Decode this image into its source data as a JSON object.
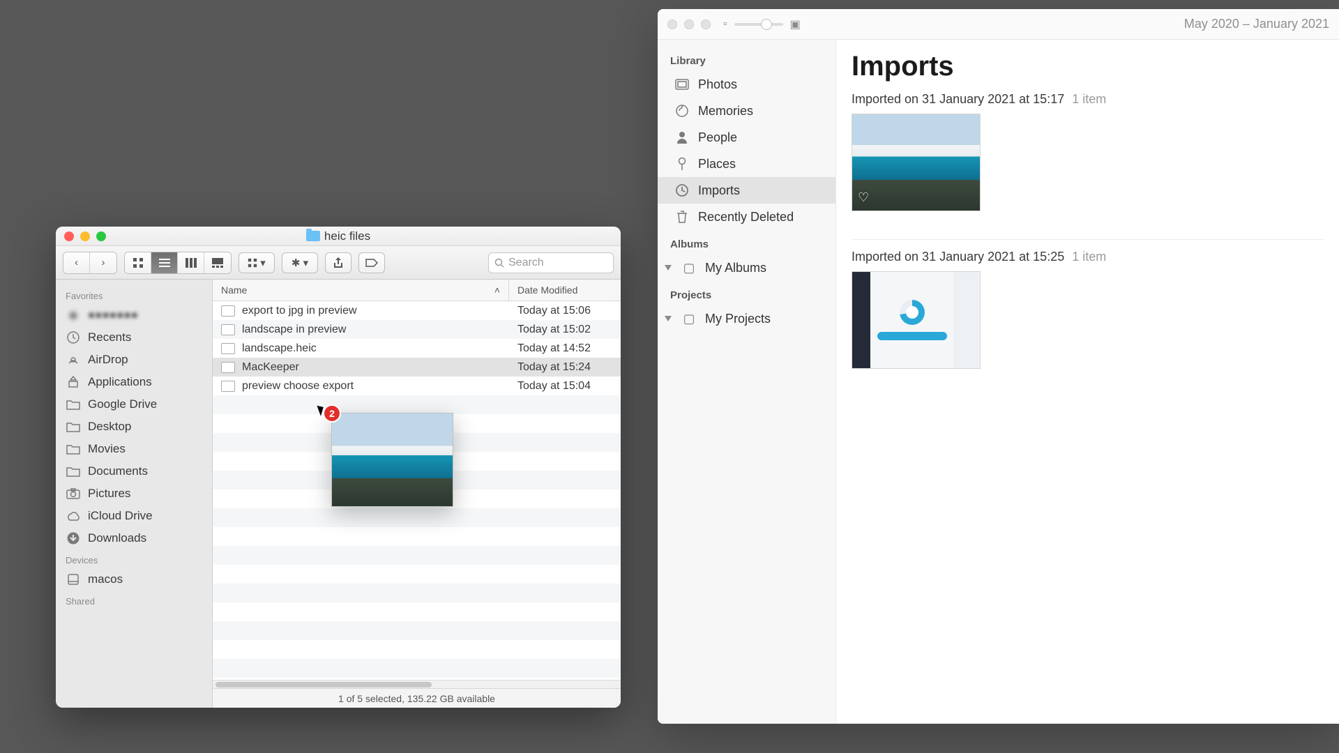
{
  "finder": {
    "title": "heic files",
    "search_placeholder": "Search",
    "sidebar": {
      "favorites_label": "Favorites",
      "devices_label": "Devices",
      "shared_label": "Shared",
      "hidden_item": "●●●●●●●",
      "favorites": [
        {
          "label": "Recents",
          "icon": "clock"
        },
        {
          "label": "AirDrop",
          "icon": "airdrop"
        },
        {
          "label": "Applications",
          "icon": "apps"
        },
        {
          "label": "Google Drive",
          "icon": "folder"
        },
        {
          "label": "Desktop",
          "icon": "folder"
        },
        {
          "label": "Movies",
          "icon": "folder"
        },
        {
          "label": "Documents",
          "icon": "folder"
        },
        {
          "label": "Pictures",
          "icon": "camera"
        },
        {
          "label": "iCloud Drive",
          "icon": "cloud"
        },
        {
          "label": "Downloads",
          "icon": "download"
        }
      ],
      "devices": [
        {
          "label": "macos",
          "icon": "disk"
        }
      ]
    },
    "columns": {
      "name": "Name",
      "date": "Date Modified"
    },
    "files": [
      {
        "name": "export to jpg in preview",
        "date": "Today at 15:06",
        "selected": false
      },
      {
        "name": "landscape in preview",
        "date": "Today at 15:02",
        "selected": false
      },
      {
        "name": "landscape.heic",
        "date": "Today at 14:52",
        "selected": false
      },
      {
        "name": "MacKeeper",
        "date": "Today at 15:24",
        "selected": true
      },
      {
        "name": "preview choose export",
        "date": "Today at 15:04",
        "selected": false
      }
    ],
    "drag_badge": "2",
    "status": "1 of 5 selected, 135.22 GB available"
  },
  "photos": {
    "date_range": "May 2020 – January 2021",
    "sidebar": {
      "library_label": "Library",
      "albums_label": "Albums",
      "projects_label": "Projects",
      "library": [
        {
          "label": "Photos",
          "icon": "photos"
        },
        {
          "label": "Memories",
          "icon": "memories"
        },
        {
          "label": "People",
          "icon": "people"
        },
        {
          "label": "Places",
          "icon": "places"
        },
        {
          "label": "Imports",
          "icon": "imports",
          "selected": true
        },
        {
          "label": "Recently Deleted",
          "icon": "trash"
        }
      ],
      "my_albums": "My Albums",
      "my_projects": "My Projects"
    },
    "main": {
      "title": "Imports",
      "groups": [
        {
          "heading": "Imported on 31 January 2021 at 15:17",
          "count": "1 item",
          "kind": "mountain"
        },
        {
          "heading": "Imported on 31 January 2021 at 15:25",
          "count": "1 item",
          "kind": "screenshot"
        }
      ]
    }
  }
}
